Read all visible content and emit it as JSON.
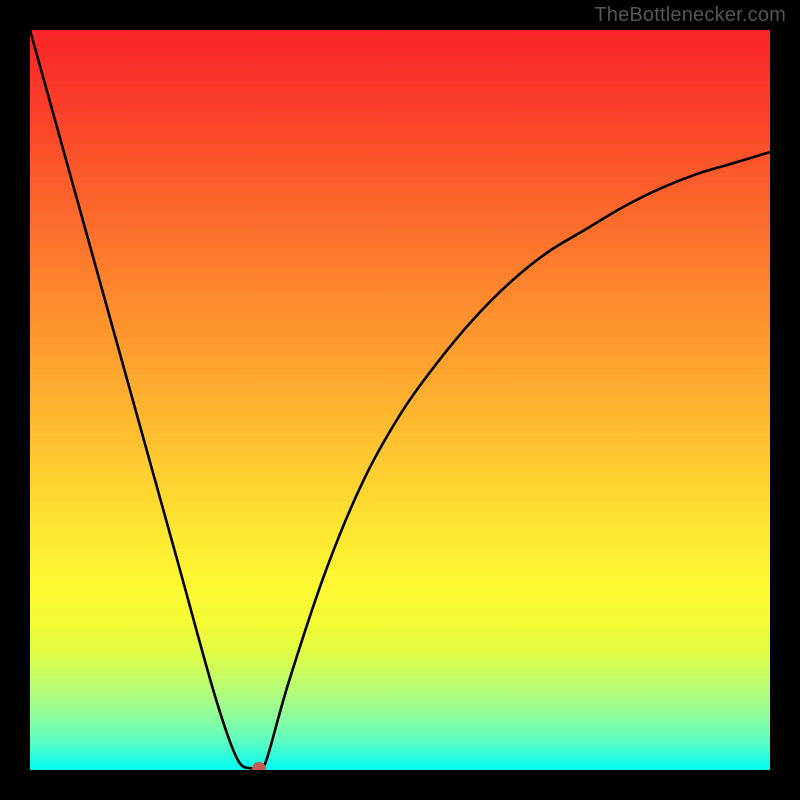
{
  "watermark": "TheBottlenecker.com",
  "chart_data": {
    "type": "line",
    "title": "",
    "xlabel": "",
    "ylabel": "",
    "xlim": [
      0,
      100
    ],
    "ylim": [
      0,
      100
    ],
    "series": [
      {
        "name": "bottleneck-curve",
        "x": [
          0,
          5,
          10,
          15,
          20,
          25,
          28,
          30,
          31,
          32,
          35,
          40,
          45,
          50,
          55,
          60,
          65,
          70,
          75,
          80,
          85,
          90,
          95,
          100
        ],
        "y": [
          100,
          82,
          64,
          46,
          28,
          10,
          1.5,
          0.2,
          0.2,
          1.5,
          12,
          27,
          39,
          48,
          55,
          61,
          66,
          70,
          73,
          76,
          78.5,
          80.5,
          82,
          83.5
        ]
      }
    ],
    "annotations": [
      {
        "name": "optimal-marker",
        "x": 31,
        "y": 0.2
      }
    ],
    "background_gradient": {
      "orientation": "vertical",
      "stops": [
        {
          "pos": 0.0,
          "color": "#fa2429"
        },
        {
          "pos": 0.5,
          "color": "#feb12f"
        },
        {
          "pos": 0.78,
          "color": "#fdf832"
        },
        {
          "pos": 1.0,
          "color": "#00fbef"
        }
      ]
    }
  }
}
